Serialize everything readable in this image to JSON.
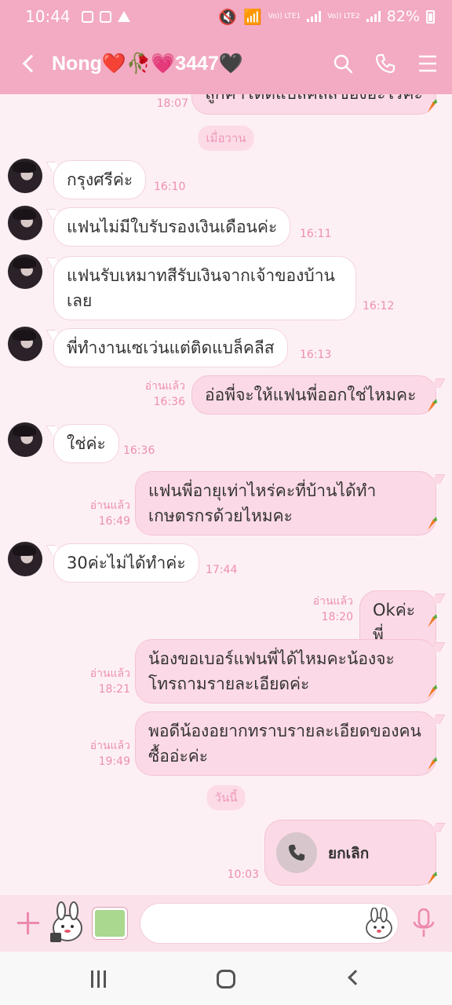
{
  "status_bar": {
    "time": "10:44",
    "lte1": "Vo)) LTE1",
    "lte2": "Vo)) LTE2",
    "battery": "82%"
  },
  "header": {
    "title": "Nong❤️🥀💗3447🖤"
  },
  "colors": {
    "header_bg": "#f3aac3",
    "chat_bg": "#fdf0f4",
    "outgoing_bubble": "#fcd9e6",
    "meta_text": "#ec8fb0"
  },
  "messages": [
    {
      "id": "m0",
      "direction": "out",
      "text": "ลูกค้าโดดแบล็คลิสของอะไรคะ",
      "time": "18:07",
      "read": ""
    },
    {
      "id": "d1",
      "type": "date",
      "text": "เมื่อวาน"
    },
    {
      "id": "m1",
      "direction": "in",
      "text": "กรุงศรีค่ะ",
      "time": "16:10"
    },
    {
      "id": "m2",
      "direction": "in",
      "text": "แฟนไม่มีใบรับรองเงินเดือนค่ะ",
      "time": "16:11"
    },
    {
      "id": "m3",
      "direction": "in",
      "text": "แฟนรับเหมาทสีรับเงินจากเจ้าของบ้านเลย",
      "time": "16:12"
    },
    {
      "id": "m4",
      "direction": "in",
      "text": "พี่ทำงานเซเว่นแต่ติดแบล็คลีส",
      "time": "16:13"
    },
    {
      "id": "m5",
      "direction": "out",
      "text": "อ่อพี่จะให้แฟนพี่ออกใช่ไหมคะ",
      "time": "16:36",
      "read": "อ่านแล้ว"
    },
    {
      "id": "m6",
      "direction": "in",
      "text": "ใช่ค่ะ",
      "time": "16:36"
    },
    {
      "id": "m7",
      "direction": "out",
      "text": "แฟนพี่อายุเท่าไหร่คะที่บ้านได้ทำเกษตรกรด้วยไหมคะ",
      "time": "16:49",
      "read": "อ่านแล้ว"
    },
    {
      "id": "m8",
      "direction": "in",
      "text": "30ค่ะไม่ได้ทำค่ะ",
      "time": "17:44"
    },
    {
      "id": "m9",
      "direction": "out",
      "text": "Okค่ะพี่",
      "time": "18:20",
      "read": "อ่านแล้ว"
    },
    {
      "id": "m10",
      "direction": "out",
      "text": "น้องขอเบอร์แฟนพี่ได้ไหมคะน้องจะโทรถามรายละเอียดค่ะ",
      "time": "18:21",
      "read": "อ่านแล้ว"
    },
    {
      "id": "m11",
      "direction": "out",
      "text": "พอดีน้องอยากทราบรายละเอียดของคนซื้ออ่ะค่ะ",
      "time": "19:49",
      "read": "อ่านแล้ว"
    },
    {
      "id": "d2",
      "type": "date",
      "text": "วันนี้"
    },
    {
      "id": "m12",
      "direction": "out",
      "type": "call",
      "text": "ยกเลิก",
      "time": "10:03"
    }
  ],
  "input": {
    "placeholder": "",
    "value": ""
  }
}
